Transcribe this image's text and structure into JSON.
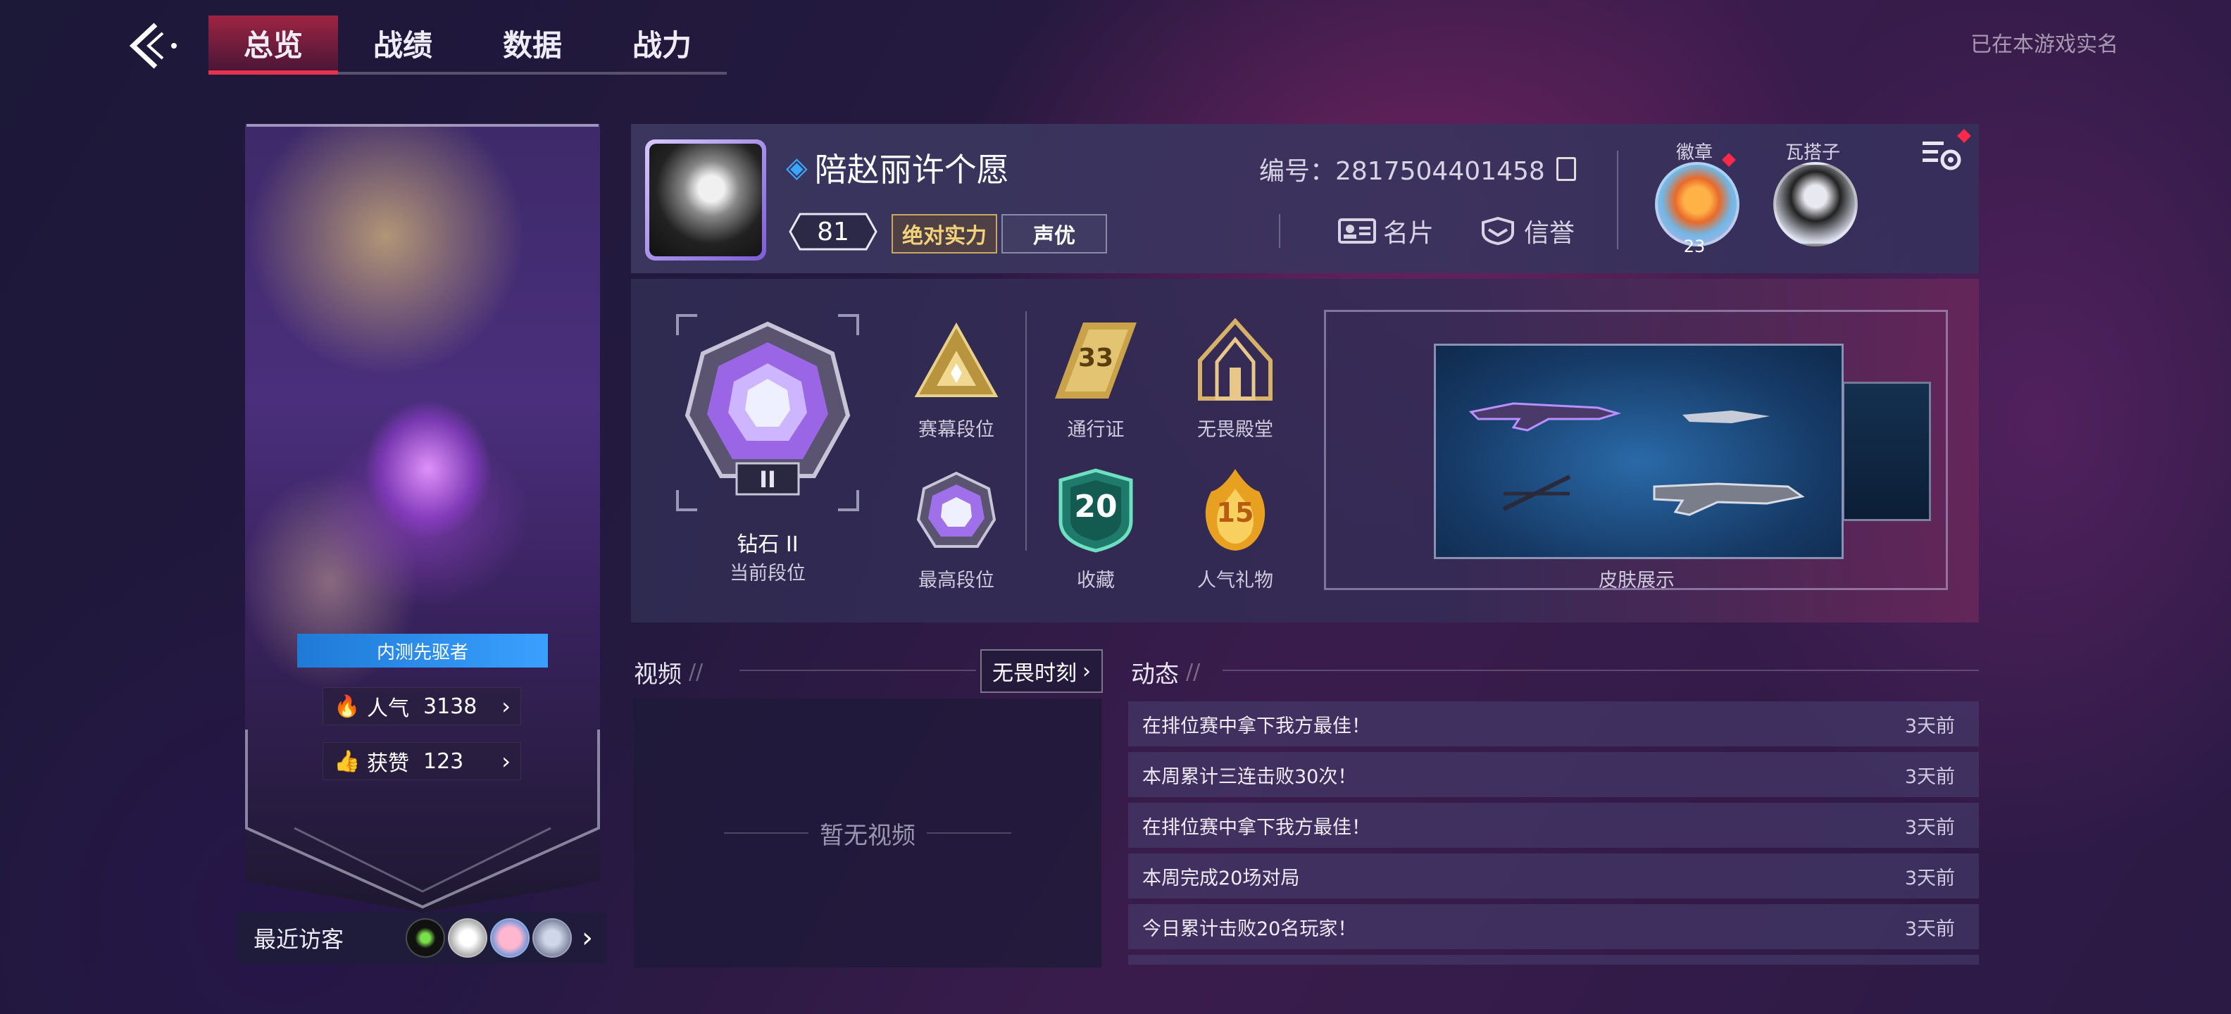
{
  "header": {
    "tabs": [
      {
        "label": "总览",
        "active": true
      },
      {
        "label": "战绩",
        "active": false
      },
      {
        "label": "数据",
        "active": false
      },
      {
        "label": "战力",
        "active": false
      }
    ],
    "realname_status": "已在本游戏实名"
  },
  "hero_card": {
    "tester_badge": "内测先驱者",
    "popularity_label": "人气",
    "popularity_value": "3138",
    "likes_label": "获赞",
    "likes_value": "123"
  },
  "visitors": {
    "label": "最近访客"
  },
  "profile": {
    "name": "陪赵丽许个愿",
    "level": "81",
    "tag_gold": "绝对实力",
    "tag_plain": "声优",
    "id_text": "编号：2817504401458",
    "card_button": "名片",
    "credit_button": "信誉",
    "badge_label": "徽章",
    "badge_count": "23",
    "buddy_label": "瓦搭子"
  },
  "ranks": {
    "current_rank_name": "钻石 II",
    "current_rank_caption": "当前段位",
    "current_rank_numeral": "II",
    "season_rank_caption": "赛幕段位",
    "highest_rank_caption": "最高段位",
    "pass_caption": "通行证",
    "pass_level": "33",
    "hall_caption": "无畏殿堂",
    "collection_caption": "收藏",
    "collection_count": "20",
    "gift_caption": "人气礼物",
    "gift_count": "15",
    "skin_caption": "皮肤展示"
  },
  "video": {
    "title": "视频",
    "fearless_button": "无畏时刻",
    "empty_text": "暂无视频"
  },
  "feed": {
    "title": "动态",
    "items": [
      {
        "text": "在排位赛中拿下我方最佳！",
        "time": "3天前"
      },
      {
        "text": "本周累计三连击败30次！",
        "time": "3天前"
      },
      {
        "text": "在排位赛中拿下我方最佳！",
        "time": "3天前"
      },
      {
        "text": "本周完成20场对局",
        "time": "3天前"
      },
      {
        "text": "今日累计击败20名玩家！",
        "time": "3天前"
      }
    ]
  },
  "colors": {
    "accent_red": "#e8324e",
    "gold": "#f3d27a",
    "tester_blue": "#3aa0ff"
  }
}
